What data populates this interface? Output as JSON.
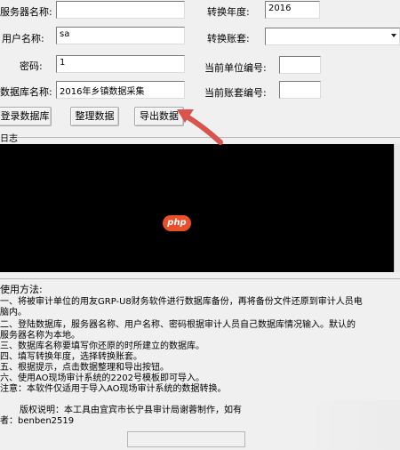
{
  "form": {
    "server_label": "服务器名称:",
    "server_value": "",
    "user_label": "用户名称:",
    "user_value": "sa",
    "password_label": "密码:",
    "password_value": "1",
    "dbname_label": "数据库名称:",
    "dbname_value": "2016年乡镇数据采集",
    "year_label": "转换年度:",
    "year_value": "2016",
    "account_set_label": "转换账套:",
    "account_set_value": "",
    "unit_code_label": "当前单位编号:",
    "unit_code_value": "",
    "set_code_label": "当前账套编号:",
    "set_code_value": ""
  },
  "buttons": {
    "login": "登录数据库",
    "organize": "整理数据",
    "export": "导出数据"
  },
  "log": {
    "label": "日志"
  },
  "usage": {
    "title": "使用方法:",
    "lines": [
      "一、将被审计单位的用友GRP-U8财务软件进行数据库备份，再将备份文件还原到审计人员电",
      "脑内。",
      "二、登陆数据库，服务器名称、用户名称、密码根据审计人员自己数据库情况输入。默认的",
      "服务器名称为本地。",
      "三、数据库名称要填写你还原的时所建立的数据库。",
      "四、填写转换年度，选择转换账套。",
      "五、根据提示，点击数据整理和导出按钮。",
      "六、使用AO现场审计系统的2202号模板即可导入。",
      "注意：本软件仅适用于导入AO现场审计系统的数据转换。"
    ],
    "copyright": "版权说明：本工具由宜宾市长宁县审计局谢蓉制作，如有",
    "author": "者：benben2519"
  },
  "logo_text": "php",
  "colors": {
    "console_bg": "#000000",
    "arrow": "#d9534f",
    "logo_bg": "#e94f2a"
  },
  "icons": {
    "dropdown": "chevron-down-icon"
  }
}
